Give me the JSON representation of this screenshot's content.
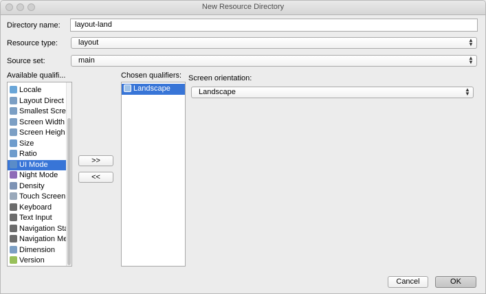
{
  "window": {
    "title": "New Resource Directory"
  },
  "form": {
    "directory_name_label": "Directory name:",
    "directory_name_value": "layout-land",
    "resource_type_label": "Resource type:",
    "resource_type_value": "layout",
    "source_set_label": "Source set:",
    "source_set_value": "main"
  },
  "qualifiers": {
    "available_label": "Available qualifi...",
    "chosen_label": "Chosen qualifiers:",
    "available_items": [
      {
        "label": "Locale",
        "icon": "locale-icon",
        "color": "#6aa6d8"
      },
      {
        "label": "Layout Direct",
        "icon": "layout-direction-icon",
        "color": "#7c9fc4"
      },
      {
        "label": "Smallest Scre",
        "icon": "smallest-screen-icon",
        "color": "#7c9fc4"
      },
      {
        "label": "Screen Width",
        "icon": "screen-width-icon",
        "color": "#7c9fc4"
      },
      {
        "label": "Screen Heigh",
        "icon": "screen-height-icon",
        "color": "#7c9fc4"
      },
      {
        "label": "Size",
        "icon": "size-icon",
        "color": "#6e9ccc"
      },
      {
        "label": "Ratio",
        "icon": "ratio-icon",
        "color": "#6e9ccc"
      },
      {
        "label": "UI Mode",
        "icon": "ui-mode-icon",
        "color": "#5a8cc8",
        "selected": true
      },
      {
        "label": "Night Mode",
        "icon": "night-mode-icon",
        "color": "#8e6bb8"
      },
      {
        "label": "Density",
        "icon": "density-icon",
        "color": "#7d93b5"
      },
      {
        "label": "Touch Screen",
        "icon": "touch-screen-icon",
        "color": "#9aa9bb"
      },
      {
        "label": "Keyboard",
        "icon": "keyboard-icon",
        "color": "#6c6c6c"
      },
      {
        "label": "Text Input",
        "icon": "text-input-icon",
        "color": "#6c6c6c"
      },
      {
        "label": "Navigation Sta",
        "icon": "navigation-state-icon",
        "color": "#6c6c6c"
      },
      {
        "label": "Navigation Me",
        "icon": "navigation-method-icon",
        "color": "#6c6c6c"
      },
      {
        "label": "Dimension",
        "icon": "dimension-icon",
        "color": "#7c9fc4"
      },
      {
        "label": "Version",
        "icon": "android-version-icon",
        "color": "#98c05a"
      }
    ],
    "chosen_items": [
      {
        "label": "Landscape",
        "icon": "orientation-icon",
        "selected": true
      }
    ],
    "add_button": ">>",
    "remove_button": "<<",
    "orientation_label": "Screen orientation:",
    "orientation_value": "Landscape"
  },
  "buttons": {
    "cancel": "Cancel",
    "ok": "OK"
  }
}
